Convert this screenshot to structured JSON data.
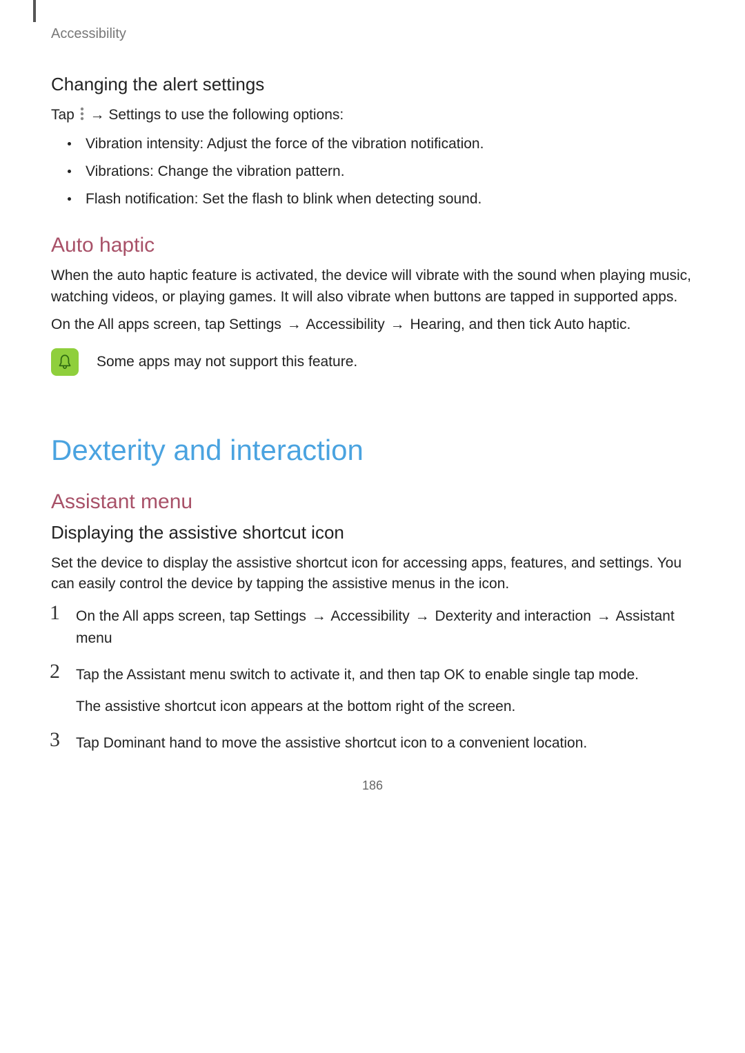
{
  "breadcrumb": "Accessibility",
  "arrow": "→",
  "sec1": {
    "heading": "Changing the alert settings",
    "intro_pre": "Tap ",
    "intro_post": " → Settings to use the following options:",
    "bullets": [
      {
        "name": "Vibration intensity",
        "desc": ": Adjust the force of the vibration notification."
      },
      {
        "name": "Vibrations",
        "desc": ": Change the vibration pattern."
      },
      {
        "name": "Flash notification",
        "desc": ": Set the flash to blink when detecting sound."
      }
    ]
  },
  "sec2": {
    "heading": "Auto haptic",
    "para": "When the auto haptic feature is activated, the device will vibrate with the sound when playing music, watching videos, or playing games. It will also vibrate when buttons are tapped in supported apps.",
    "path_pre": "On the All apps screen, tap Settings",
    "path_a": "Accessibility",
    "path_b": "Hearing, and then tick Auto haptic.",
    "note": "Some apps may not support this feature."
  },
  "sec3": {
    "h1": "Dexterity and interaction",
    "h2": "Assistant menu",
    "h3": "Displaying the assistive shortcut icon",
    "para": "Set the device to display the assistive shortcut icon for accessing apps, features, and settings. You can easily control the device by tapping the assistive menus in the icon.",
    "steps": {
      "s1_pre": "On the All apps screen, tap Settings",
      "s1_a": "Accessibility",
      "s1_b": "Dexterity and interaction",
      "s1_c": "Assistant menu",
      "s2_l1": "Tap the Assistant menu switch to activate it, and then tap OK to enable single tap mode.",
      "s2_l2": "The assistive shortcut icon appears at the bottom right of the screen.",
      "s3": "Tap Dominant hand to move the assistive shortcut icon to a convenient location."
    },
    "nums": {
      "n1": "1",
      "n2": "2",
      "n3": "3"
    }
  },
  "page_number": "186"
}
